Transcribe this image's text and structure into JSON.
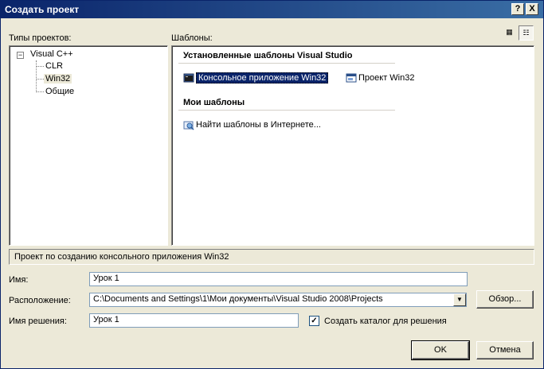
{
  "window": {
    "title": "Создать проект",
    "help_label": "?",
    "close_label": "X"
  },
  "project_types": {
    "label": "Типы проектов:",
    "root": "Visual C++",
    "root_expander": "−",
    "children": [
      "CLR",
      "Win32",
      "Общие"
    ]
  },
  "templates": {
    "label": "Шаблоны:",
    "installed_header": "Установленные шаблоны Visual Studio",
    "installed": [
      {
        "label": "Консольное приложение Win32"
      },
      {
        "label": "Проект Win32"
      }
    ],
    "my_header": "Мои шаблоны",
    "my": [
      {
        "label": "Найти шаблоны в Интернете..."
      }
    ]
  },
  "description": "Проект по созданию консольного приложения Win32",
  "form": {
    "name_label": "Имя:",
    "name_value": "Урок 1",
    "location_label": "Расположение:",
    "location_value": "C:\\Documents and Settings\\1\\Мои документы\\Visual Studio 2008\\Projects",
    "browse_label": "Обзор...",
    "solution_label": "Имя решения:",
    "solution_value": "Урок 1",
    "create_dir_label": "Создать каталог для решения",
    "create_dir_checked": true,
    "check_mark": "✓"
  },
  "buttons": {
    "ok": "OK",
    "cancel": "Отмена"
  }
}
